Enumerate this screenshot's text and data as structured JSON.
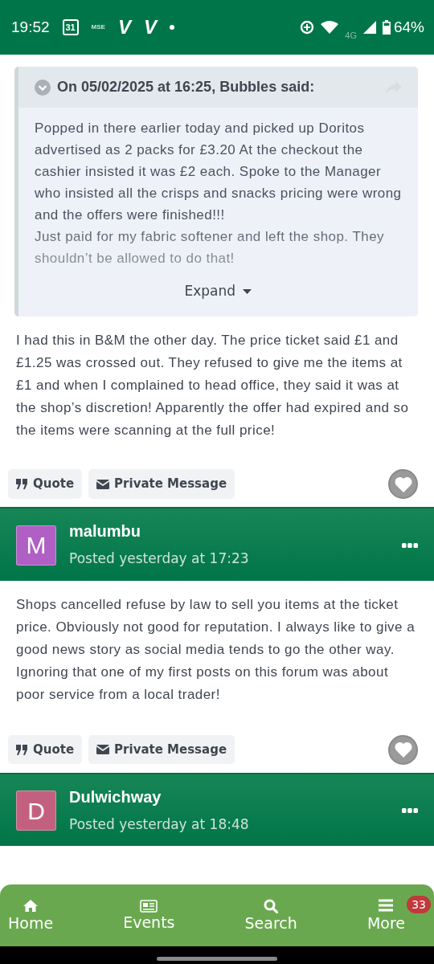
{
  "status_bar": {
    "time": "19:52",
    "calendar_day": "31",
    "small_label": "MSE",
    "notification_letters": [
      "V",
      "V"
    ],
    "network": "4G",
    "battery": "64%"
  },
  "posts": [
    {
      "kind": "continued",
      "quote": {
        "header": "On 05/02/2025 at 16:25, Bubbles said:",
        "paragraphs": [
          "Popped in there earlier today and picked up Doritos advertised as 2 packs for £3.20 At the checkout the cashier insisted it was £2 each. Spoke to the Manager who insisted all the crisps and snacks pricing were wrong and the offers were finished!!!",
          "Just paid for my fabric softener and left the shop. They shouldn’t be allowed to do that!"
        ],
        "expand": "Expand"
      },
      "text": "I had this in B&M the other day. The price ticket said £1 and £1.25 was crossed out. They refused to give me the items at £1 and when I complained to head office, they said it was at the shop’s discretion! Apparently the offer had expired and so the items were scanning at the full price!",
      "actions": [
        "Quote",
        "Private Message"
      ],
      "liked": false
    },
    {
      "kind": "full",
      "author": "malumbu",
      "initial": "M",
      "color": "#b05fc4",
      "posted": "Posted yesterday at 17:23",
      "text": "Shops cancelled refuse by law to sell you items at the ticket price.  Obviously not good for reputation.  I always like to give a good news story as social media tends to go the other way.  Ignoring that one of my first posts on this forum was about poor service from a local trader!",
      "actions": [
        "Quote",
        "Private Message"
      ],
      "liked": false
    },
    {
      "kind": "header",
      "author": "Dulwichway",
      "initial": "D",
      "color": "#c4607f",
      "posted": "Posted yesterday at 18:48"
    }
  ],
  "bottom_nav": [
    {
      "kind": "home",
      "label": "Home"
    },
    {
      "kind": "events",
      "label": "Events"
    },
    {
      "kind": "search",
      "label": "Search"
    },
    {
      "kind": "more",
      "label": "More",
      "badge": "33"
    }
  ]
}
